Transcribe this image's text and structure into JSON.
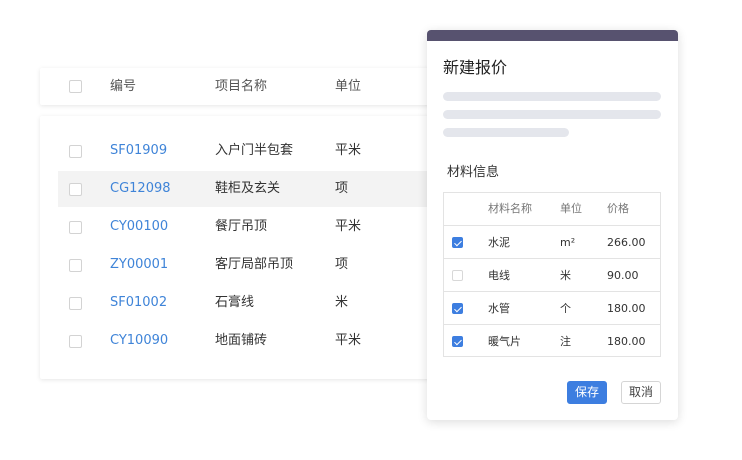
{
  "list": {
    "headers": {
      "code": "编号",
      "name": "项目名称",
      "unit": "单位"
    },
    "rows": [
      {
        "code": "SF01909",
        "name": "入户门半包套",
        "unit": "平米",
        "highlighted": false
      },
      {
        "code": "CG12098",
        "name": "鞋柜及玄关",
        "unit": "项",
        "highlighted": true
      },
      {
        "code": "CY00100",
        "name": "餐厅吊顶",
        "unit": "平米",
        "highlighted": false
      },
      {
        "code": "ZY00001",
        "name": "客厅局部吊顶",
        "unit": "项",
        "highlighted": false
      },
      {
        "code": "SF01002",
        "name": "石膏线",
        "unit": "米",
        "highlighted": false
      },
      {
        "code": "CY10090",
        "name": "地面铺砖",
        "unit": "平米",
        "highlighted": false
      }
    ]
  },
  "dialog": {
    "title": "新建报价",
    "section_title": "材料信息",
    "materials": {
      "headers": {
        "name": "材料名称",
        "unit": "单位",
        "price": "价格"
      },
      "rows": [
        {
          "checked": true,
          "name": "水泥",
          "unit": "m²",
          "price": "266.00"
        },
        {
          "checked": false,
          "name": "电线",
          "unit": "米",
          "price": "90.00"
        },
        {
          "checked": true,
          "name": "水管",
          "unit": "个",
          "price": "180.00"
        },
        {
          "checked": true,
          "name": "暖气片",
          "unit": "注",
          "price": "180.00"
        }
      ]
    },
    "save_label": "保存",
    "cancel_label": "取消"
  },
  "colors": {
    "accent": "#3d7ee0",
    "link": "#3f84d8",
    "dialog_header": "#57526f",
    "skeleton": "#e4e6ec",
    "row_highlight": "#f3f3f3"
  }
}
